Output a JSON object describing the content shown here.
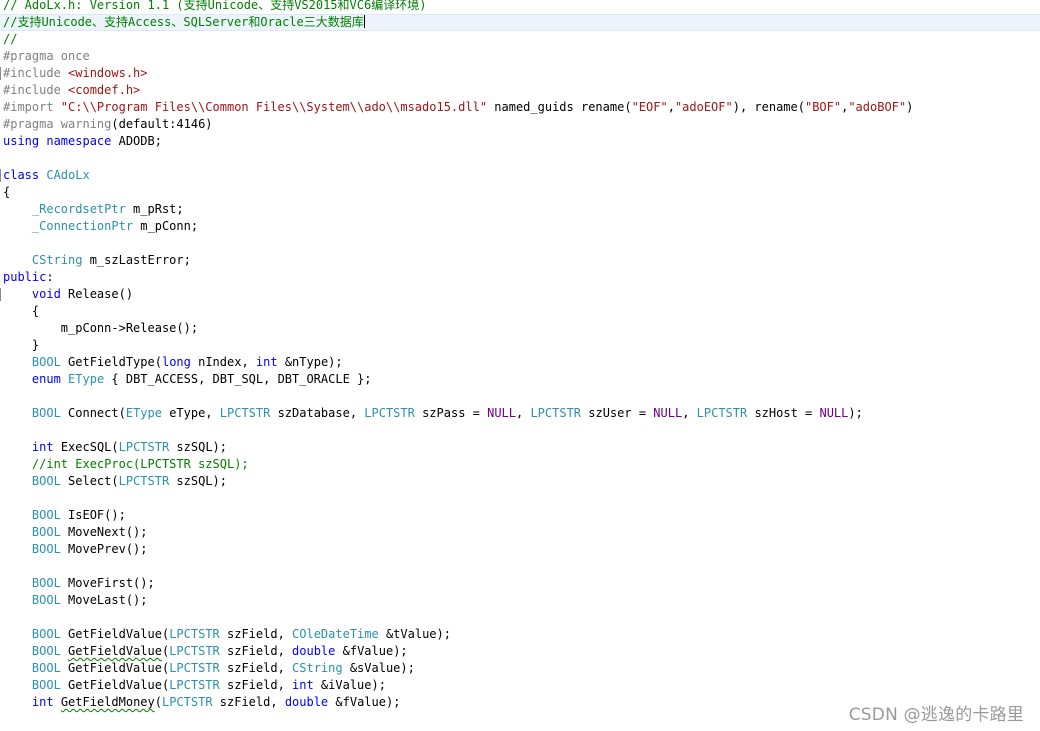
{
  "editor": {
    "current_line": 1,
    "lines": [
      {
        "fold": false,
        "tokens": [
          {
            "t": "// AdoLx.h: Version 1.1 (支持Unicode、支持VS2015和VC6编译环境)",
            "c": "com"
          }
        ]
      },
      {
        "fold": false,
        "tokens": [
          {
            "t": "//支持Unicode、支持Access、SQLServer和Oracle三大数据库",
            "c": "com"
          }
        ]
      },
      {
        "fold": false,
        "tokens": [
          {
            "t": "//",
            "c": "com"
          }
        ]
      },
      {
        "fold": false,
        "tokens": [
          {
            "t": "#pragma once",
            "c": "pp"
          }
        ]
      },
      {
        "fold": true,
        "tokens": [
          {
            "t": "#include ",
            "c": "pp"
          },
          {
            "t": "<windows.h>",
            "c": "str"
          }
        ]
      },
      {
        "fold": false,
        "tokens": [
          {
            "t": "#include ",
            "c": "pp"
          },
          {
            "t": "<comdef.h>",
            "c": "str"
          }
        ]
      },
      {
        "fold": false,
        "tokens": [
          {
            "t": "#import ",
            "c": "pp"
          },
          {
            "t": "\"C:\\\\Program Files\\\\Common Files\\\\System\\\\ado\\\\msado15.dll\"",
            "c": "str"
          },
          {
            "t": " named_guids rename(",
            "c": "pl"
          },
          {
            "t": "\"EOF\"",
            "c": "str"
          },
          {
            "t": ",",
            "c": "pl"
          },
          {
            "t": "\"adoEOF\"",
            "c": "str"
          },
          {
            "t": "), rename(",
            "c": "pl"
          },
          {
            "t": "\"BOF\"",
            "c": "str"
          },
          {
            "t": ",",
            "c": "pl"
          },
          {
            "t": "\"adoBOF\"",
            "c": "str"
          },
          {
            "t": ")",
            "c": "pl"
          }
        ]
      },
      {
        "fold": false,
        "tokens": [
          {
            "t": "#pragma warning",
            "c": "pp"
          },
          {
            "t": "(default:4146)",
            "c": "pl"
          }
        ]
      },
      {
        "fold": false,
        "tokens": [
          {
            "t": "using namespace",
            "c": "kw"
          },
          {
            "t": " ADODB;",
            "c": "pl"
          }
        ]
      },
      {
        "fold": false,
        "tokens": []
      },
      {
        "fold": true,
        "tokens": [
          {
            "t": "class",
            "c": "kw"
          },
          {
            "t": " ",
            "c": "pl"
          },
          {
            "t": "CAdoLx",
            "c": "type"
          }
        ]
      },
      {
        "fold": false,
        "tokens": [
          {
            "t": "{",
            "c": "pl"
          }
        ]
      },
      {
        "fold": false,
        "tokens": [
          {
            "t": "    ",
            "c": "pl"
          },
          {
            "t": "_RecordsetPtr",
            "c": "type"
          },
          {
            "t": " m_pRst;",
            "c": "pl"
          }
        ]
      },
      {
        "fold": false,
        "tokens": [
          {
            "t": "    ",
            "c": "pl"
          },
          {
            "t": "_ConnectionPtr",
            "c": "type"
          },
          {
            "t": " m_pConn;",
            "c": "pl"
          }
        ]
      },
      {
        "fold": false,
        "tokens": []
      },
      {
        "fold": false,
        "tokens": [
          {
            "t": "    ",
            "c": "pl"
          },
          {
            "t": "CString",
            "c": "type"
          },
          {
            "t": " m_szLastError;",
            "c": "pl"
          }
        ]
      },
      {
        "fold": false,
        "tokens": [
          {
            "t": "public",
            "c": "kw"
          },
          {
            "t": ":",
            "c": "pl"
          }
        ]
      },
      {
        "fold": true,
        "tokens": [
          {
            "t": "    ",
            "c": "pl"
          },
          {
            "t": "void",
            "c": "kw"
          },
          {
            "t": " Release()",
            "c": "pl"
          }
        ]
      },
      {
        "fold": false,
        "tokens": [
          {
            "t": "    {",
            "c": "pl"
          }
        ]
      },
      {
        "fold": false,
        "tokens": [
          {
            "t": "        m_pConn->Release();",
            "c": "pl"
          }
        ]
      },
      {
        "fold": false,
        "tokens": [
          {
            "t": "    }",
            "c": "pl"
          }
        ]
      },
      {
        "fold": false,
        "tokens": [
          {
            "t": "    ",
            "c": "pl"
          },
          {
            "t": "BOOL",
            "c": "type"
          },
          {
            "t": " GetFieldType(",
            "c": "pl"
          },
          {
            "t": "long",
            "c": "kw"
          },
          {
            "t": " nIndex, ",
            "c": "pl"
          },
          {
            "t": "int",
            "c": "kw"
          },
          {
            "t": " &nType);",
            "c": "pl"
          }
        ]
      },
      {
        "fold": false,
        "tokens": [
          {
            "t": "    ",
            "c": "pl"
          },
          {
            "t": "enum",
            "c": "kw"
          },
          {
            "t": " ",
            "c": "pl"
          },
          {
            "t": "EType",
            "c": "type"
          },
          {
            "t": " { DBT_ACCESS, DBT_SQL, DBT_ORACLE };",
            "c": "pl"
          }
        ]
      },
      {
        "fold": false,
        "tokens": []
      },
      {
        "fold": false,
        "tokens": [
          {
            "t": "    ",
            "c": "pl"
          },
          {
            "t": "BOOL",
            "c": "type"
          },
          {
            "t": " Connect(",
            "c": "pl"
          },
          {
            "t": "EType",
            "c": "type"
          },
          {
            "t": " eType, ",
            "c": "pl"
          },
          {
            "t": "LPCTSTR",
            "c": "type"
          },
          {
            "t": " szDatabase, ",
            "c": "pl"
          },
          {
            "t": "LPCTSTR",
            "c": "type"
          },
          {
            "t": " szPass = ",
            "c": "pl"
          },
          {
            "t": "NULL",
            "c": "mac"
          },
          {
            "t": ", ",
            "c": "pl"
          },
          {
            "t": "LPCTSTR",
            "c": "type"
          },
          {
            "t": " szUser = ",
            "c": "pl"
          },
          {
            "t": "NULL",
            "c": "mac"
          },
          {
            "t": ", ",
            "c": "pl"
          },
          {
            "t": "LPCTSTR",
            "c": "type"
          },
          {
            "t": " szHost = ",
            "c": "pl"
          },
          {
            "t": "NULL",
            "c": "mac"
          },
          {
            "t": ");",
            "c": "pl"
          }
        ]
      },
      {
        "fold": false,
        "tokens": []
      },
      {
        "fold": false,
        "tokens": [
          {
            "t": "    ",
            "c": "pl"
          },
          {
            "t": "int",
            "c": "kw"
          },
          {
            "t": " ExecSQL(",
            "c": "pl"
          },
          {
            "t": "LPCTSTR",
            "c": "type"
          },
          {
            "t": " szSQL);",
            "c": "pl"
          }
        ]
      },
      {
        "fold": false,
        "tokens": [
          {
            "t": "    ",
            "c": "pl"
          },
          {
            "t": "//int ExecProc(LPCTSTR szSQL);",
            "c": "com"
          }
        ]
      },
      {
        "fold": false,
        "tokens": [
          {
            "t": "    ",
            "c": "pl"
          },
          {
            "t": "BOOL",
            "c": "type"
          },
          {
            "t": " Select(",
            "c": "pl"
          },
          {
            "t": "LPCTSTR",
            "c": "type"
          },
          {
            "t": " szSQL);",
            "c": "pl"
          }
        ]
      },
      {
        "fold": false,
        "tokens": []
      },
      {
        "fold": false,
        "tokens": [
          {
            "t": "    ",
            "c": "pl"
          },
          {
            "t": "BOOL",
            "c": "type"
          },
          {
            "t": " IsEOF();",
            "c": "pl"
          }
        ]
      },
      {
        "fold": false,
        "tokens": [
          {
            "t": "    ",
            "c": "pl"
          },
          {
            "t": "BOOL",
            "c": "type"
          },
          {
            "t": " MoveNext();",
            "c": "pl"
          }
        ]
      },
      {
        "fold": false,
        "tokens": [
          {
            "t": "    ",
            "c": "pl"
          },
          {
            "t": "BOOL",
            "c": "type"
          },
          {
            "t": " MovePrev();",
            "c": "pl"
          }
        ]
      },
      {
        "fold": false,
        "tokens": []
      },
      {
        "fold": false,
        "tokens": [
          {
            "t": "    ",
            "c": "pl"
          },
          {
            "t": "BOOL",
            "c": "type"
          },
          {
            "t": " MoveFirst();",
            "c": "pl"
          }
        ]
      },
      {
        "fold": false,
        "tokens": [
          {
            "t": "    ",
            "c": "pl"
          },
          {
            "t": "BOOL",
            "c": "type"
          },
          {
            "t": " MoveLast();",
            "c": "pl"
          }
        ]
      },
      {
        "fold": false,
        "tokens": []
      },
      {
        "fold": false,
        "tokens": [
          {
            "t": "    ",
            "c": "pl"
          },
          {
            "t": "BOOL",
            "c": "type"
          },
          {
            "t": " GetFieldValue(",
            "c": "pl"
          },
          {
            "t": "LPCTSTR",
            "c": "type"
          },
          {
            "t": " szField, ",
            "c": "pl"
          },
          {
            "t": "COleDateTime",
            "c": "type"
          },
          {
            "t": " &tValue);",
            "c": "pl"
          }
        ]
      },
      {
        "fold": false,
        "tokens": [
          {
            "t": "    ",
            "c": "pl"
          },
          {
            "t": "BOOL",
            "c": "type"
          },
          {
            "t": " ",
            "c": "pl"
          },
          {
            "t": "GetFieldValue",
            "c": "pl",
            "sq": true
          },
          {
            "t": "(",
            "c": "pl"
          },
          {
            "t": "LPCTSTR",
            "c": "type"
          },
          {
            "t": " szField, ",
            "c": "pl"
          },
          {
            "t": "double",
            "c": "kw"
          },
          {
            "t": " &fValue);",
            "c": "pl"
          }
        ]
      },
      {
        "fold": false,
        "tokens": [
          {
            "t": "    ",
            "c": "pl"
          },
          {
            "t": "BOOL",
            "c": "type"
          },
          {
            "t": " GetFieldValue(",
            "c": "pl"
          },
          {
            "t": "LPCTSTR",
            "c": "type"
          },
          {
            "t": " szField, ",
            "c": "pl"
          },
          {
            "t": "CString",
            "c": "type"
          },
          {
            "t": " &sValue);",
            "c": "pl"
          }
        ]
      },
      {
        "fold": false,
        "tokens": [
          {
            "t": "    ",
            "c": "pl"
          },
          {
            "t": "BOOL",
            "c": "type"
          },
          {
            "t": " GetFieldValue(",
            "c": "pl"
          },
          {
            "t": "LPCTSTR",
            "c": "type"
          },
          {
            "t": " szField, ",
            "c": "pl"
          },
          {
            "t": "int",
            "c": "kw"
          },
          {
            "t": " &iValue);",
            "c": "pl"
          }
        ]
      },
      {
        "fold": false,
        "tokens": [
          {
            "t": "    ",
            "c": "pl"
          },
          {
            "t": "int",
            "c": "kw"
          },
          {
            "t": " ",
            "c": "pl"
          },
          {
            "t": "GetFieldMoney",
            "c": "pl",
            "sq": true
          },
          {
            "t": "(",
            "c": "pl"
          },
          {
            "t": "LPCTSTR",
            "c": "type"
          },
          {
            "t": " szField, ",
            "c": "pl"
          },
          {
            "t": "double",
            "c": "kw"
          },
          {
            "t": " &fValue);",
            "c": "pl"
          }
        ]
      }
    ]
  },
  "watermark": {
    "text": "CSDN @逃逸的卡路里"
  }
}
